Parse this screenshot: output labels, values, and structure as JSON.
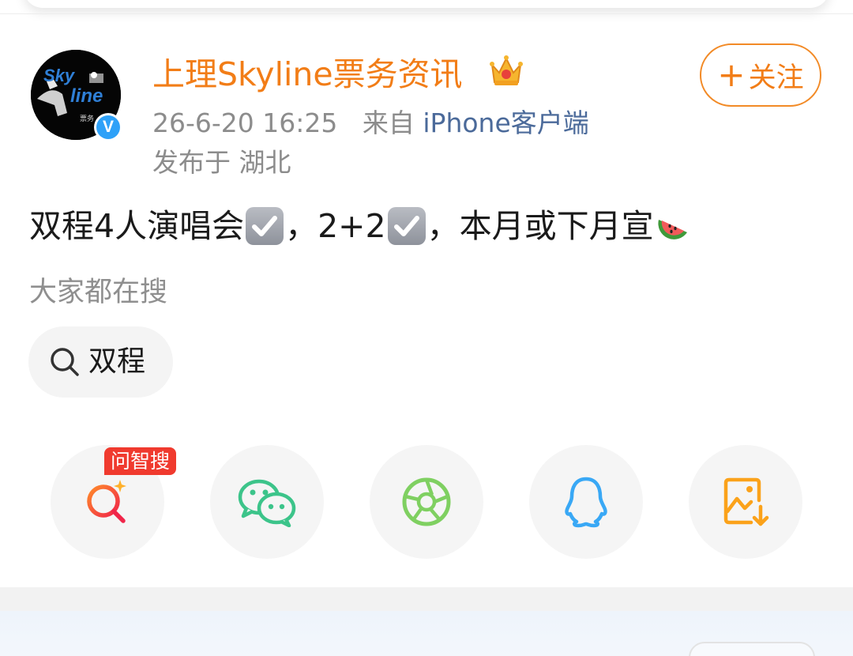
{
  "post": {
    "username": "上理Skyline票务资讯",
    "timestamp": "26-6-20 16:25",
    "source_prefix": "来自",
    "source": "iPhone客户端",
    "location": "发布于 湖北",
    "follow_label": "关注",
    "text_part1": "双程4人演唱会",
    "text_part2": "，2+2",
    "text_part3": "，本月或下月宣",
    "avatar_text": "Sky line"
  },
  "search_hint": {
    "title": "大家都在搜",
    "chip_label": "双程"
  },
  "share": {
    "ai_badge": "问智搜",
    "items": [
      "ai-search",
      "wechat",
      "moments",
      "qq",
      "save-image"
    ]
  },
  "colors": {
    "brand_orange": "#f27d17",
    "verified_blue": "#2ea1f8",
    "ai_red": "#f03a2e",
    "wechat_green": "#3cc48a",
    "moments_green": "#7fd061",
    "qq_blue": "#39a8f5",
    "save_orange": "#fba21a"
  }
}
